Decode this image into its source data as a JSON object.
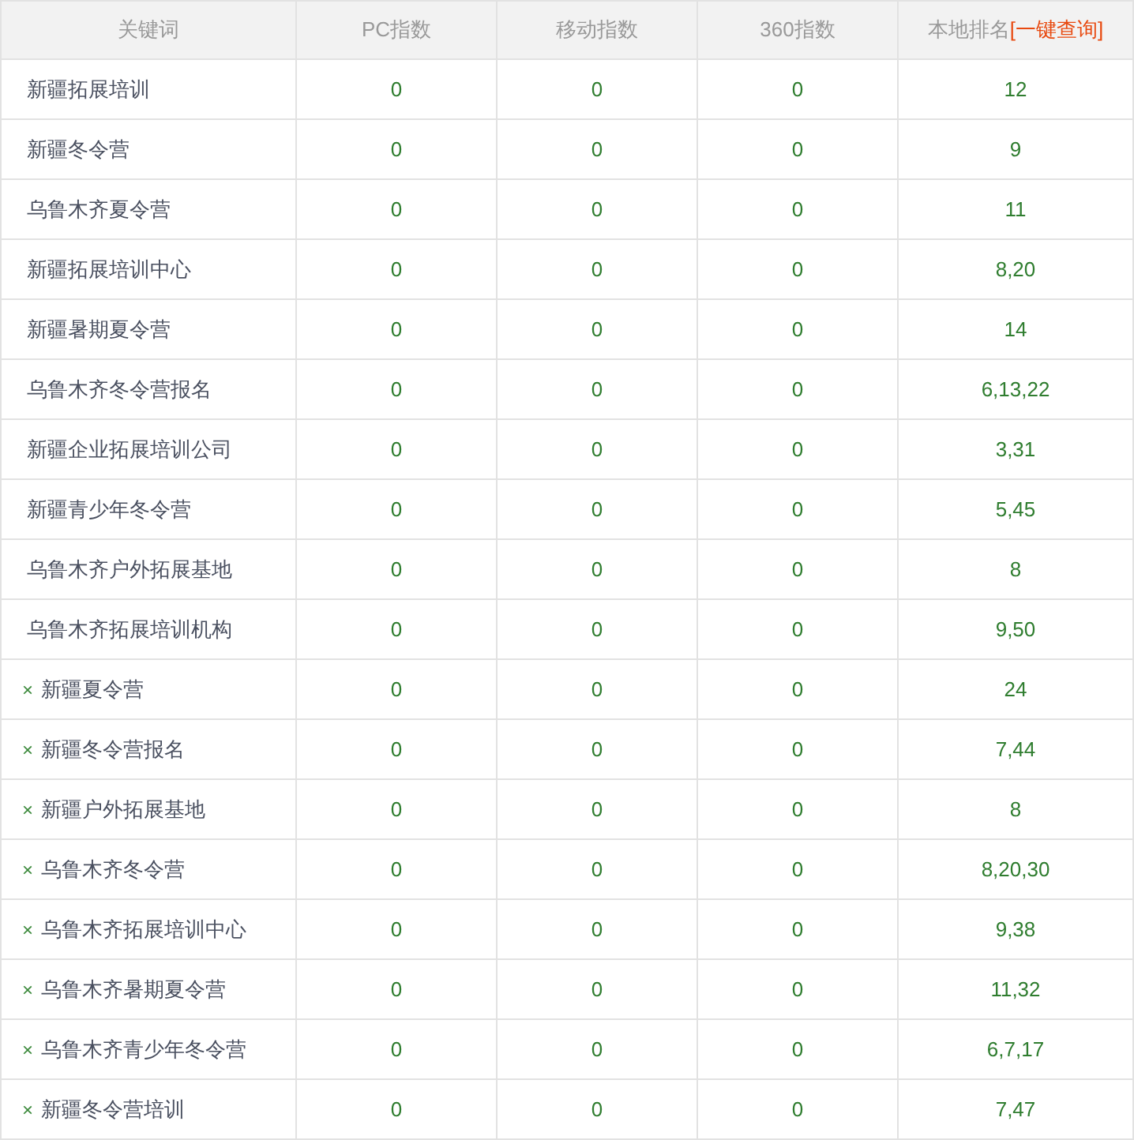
{
  "table": {
    "columns": [
      {
        "label": "关键词"
      },
      {
        "label": "PC指数"
      },
      {
        "label": "移动指数"
      },
      {
        "label": "360指数"
      },
      {
        "label": "本地排名",
        "link": "[一键查询]"
      }
    ],
    "rows": [
      {
        "keyword": "新疆拓展培训",
        "pc": "0",
        "mobile": "0",
        "s360": "0",
        "rank": "12"
      },
      {
        "keyword": "新疆冬令营",
        "pc": "0",
        "mobile": "0",
        "s360": "0",
        "rank": "9"
      },
      {
        "keyword": "乌鲁木齐夏令营",
        "pc": "0",
        "mobile": "0",
        "s360": "0",
        "rank": "11"
      },
      {
        "keyword": "新疆拓展培训中心",
        "pc": "0",
        "mobile": "0",
        "s360": "0",
        "rank": "8,20"
      },
      {
        "keyword": "新疆暑期夏令营",
        "pc": "0",
        "mobile": "0",
        "s360": "0",
        "rank": "14"
      },
      {
        "keyword": "乌鲁木齐冬令营报名",
        "pc": "0",
        "mobile": "0",
        "s360": "0",
        "rank": "6,13,22"
      },
      {
        "keyword": "新疆企业拓展培训公司",
        "pc": "0",
        "mobile": "0",
        "s360": "0",
        "rank": "3,31"
      },
      {
        "keyword": "新疆青少年冬令营",
        "pc": "0",
        "mobile": "0",
        "s360": "0",
        "rank": "5,45"
      },
      {
        "keyword": "乌鲁木齐户外拓展基地",
        "pc": "0",
        "mobile": "0",
        "s360": "0",
        "rank": "8"
      },
      {
        "keyword": "乌鲁木齐拓展培训机构",
        "pc": "0",
        "mobile": "0",
        "s360": "0",
        "rank": "9,50"
      },
      {
        "remove": "×",
        "keyword": "新疆夏令营",
        "pc": "0",
        "mobile": "0",
        "s360": "0",
        "rank": "24"
      },
      {
        "remove": "×",
        "keyword": "新疆冬令营报名",
        "pc": "0",
        "mobile": "0",
        "s360": "0",
        "rank": "7,44"
      },
      {
        "remove": "×",
        "keyword": "新疆户外拓展基地",
        "pc": "0",
        "mobile": "0",
        "s360": "0",
        "rank": "8"
      },
      {
        "remove": "×",
        "keyword": "乌鲁木齐冬令营",
        "pc": "0",
        "mobile": "0",
        "s360": "0",
        "rank": "8,20,30"
      },
      {
        "remove": "×",
        "keyword": "乌鲁木齐拓展培训中心",
        "pc": "0",
        "mobile": "0",
        "s360": "0",
        "rank": "9,38"
      },
      {
        "remove": "×",
        "keyword": "乌鲁木齐暑期夏令营",
        "pc": "0",
        "mobile": "0",
        "s360": "0",
        "rank": "11,32"
      },
      {
        "remove": "×",
        "keyword": "乌鲁木齐青少年冬令营",
        "pc": "0",
        "mobile": "0",
        "s360": "0",
        "rank": "6,7,17"
      },
      {
        "remove": "×",
        "keyword": "新疆冬令营培训",
        "pc": "0",
        "mobile": "0",
        "s360": "0",
        "rank": "7,47"
      }
    ]
  }
}
